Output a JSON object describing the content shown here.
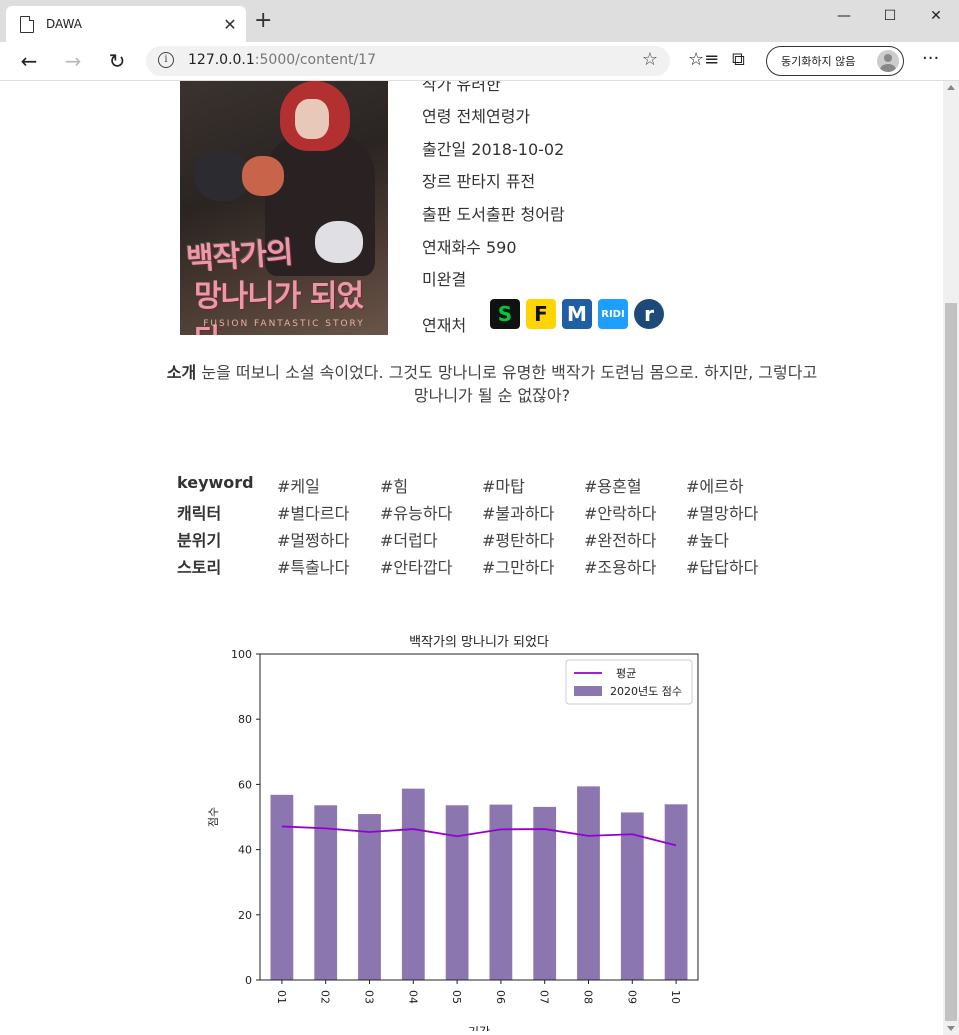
{
  "browser": {
    "tab_title": "DAWA",
    "url_host": "127.0.0.1",
    "url_rest": ":5000/content/17",
    "sync_label": "동기화하지 않음"
  },
  "book": {
    "cover_title_1": "백작가의",
    "cover_title_2": "망나니가 되었다",
    "cover_subtitle": "FUSION FANTASTIC STORY",
    "author_label": "작가",
    "author": "유려한",
    "age_label": "연령",
    "age": "전체연령가",
    "date_label": "출간일",
    "date": "2018-10-02",
    "genre_label": "장르",
    "genre": "판타지 퓨전",
    "publisher_label": "출판",
    "publisher": "도서출판 청어람",
    "episodes_label": "연재화수",
    "episodes": "590",
    "status": "미완결",
    "platforms_label": "연재처",
    "platforms": [
      {
        "name": "series",
        "glyph": "S",
        "bg": "#111111",
        "fg": "#00c73c"
      },
      {
        "name": "kakaopage",
        "glyph": "F",
        "bg": "#ffd400",
        "fg": "#111111"
      },
      {
        "name": "munpia",
        "glyph": "M",
        "bg": "#1f5fa8",
        "fg": "#ffffff"
      },
      {
        "name": "ridi",
        "glyph": "RIDI",
        "bg": "#1e9eff",
        "fg": "#ffffff"
      },
      {
        "name": "joara",
        "glyph": "r",
        "bg": "#1c4b7a",
        "fg": "#ffffff"
      }
    ]
  },
  "intro": {
    "label": "소개",
    "text": "눈을 떠보니 소설 속이었다. 그것도 망나니로 유명한 백작가 도련님 몸으로. 하지만, 그렇다고 망나니가 될 순 없잖아?"
  },
  "keywords": [
    {
      "header": "keyword",
      "tags": [
        "#케일",
        "#힘",
        "#마탑",
        "#용혼혈",
        "#에르하"
      ]
    },
    {
      "header": "캐릭터",
      "tags": [
        "#별다르다",
        "#유능하다",
        "#불과하다",
        "#안락하다",
        "#멸망하다"
      ]
    },
    {
      "header": "분위기",
      "tags": [
        "#멀쩡하다",
        "#더럽다",
        "#평탄하다",
        "#완전하다",
        "#높다"
      ]
    },
    {
      "header": "스토리",
      "tags": [
        "#특출나다",
        "#안타깝다",
        "#그만하다",
        "#조용하다",
        "#답답하다"
      ]
    }
  ],
  "chart_data": {
    "type": "bar",
    "title": "백작가의 망나니가 되었다",
    "xlabel": "기간",
    "ylabel": "점수",
    "categories": [
      "01",
      "02",
      "03",
      "04",
      "05",
      "06",
      "07",
      "08",
      "09",
      "10"
    ],
    "ylim": [
      0,
      100
    ],
    "yticks": [
      0,
      20,
      40,
      60,
      80,
      100
    ],
    "series": [
      {
        "name": "2020년도 점수",
        "kind": "bar",
        "color": "#8b76b0",
        "values": [
          56.8,
          53.6,
          50.9,
          58.7,
          53.6,
          53.8,
          53.1,
          59.4,
          51.4,
          53.9
        ]
      },
      {
        "name": "평균",
        "kind": "line",
        "color": "#9400d3",
        "values": [
          47.1,
          46.5,
          45.4,
          46.3,
          44.1,
          46.2,
          46.3,
          44.2,
          44.7,
          41.3
        ]
      }
    ],
    "legend": "top-right",
    "grid": false
  }
}
